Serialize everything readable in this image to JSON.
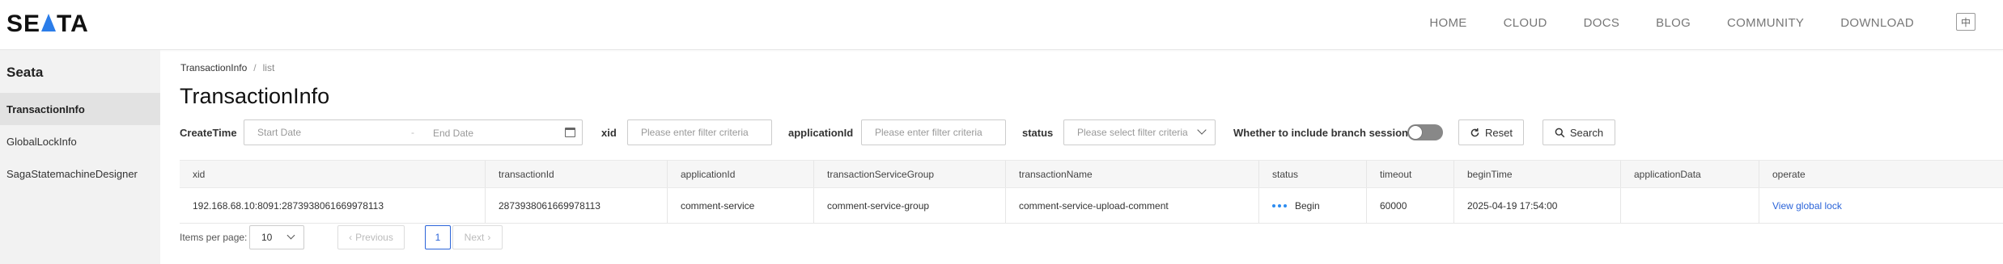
{
  "brand": {
    "logo_text_left": "SE",
    "logo_text_right": "TA"
  },
  "nav": {
    "items": [
      "HOME",
      "CLOUD",
      "DOCS",
      "BLOG",
      "COMMUNITY",
      "DOWNLOAD"
    ],
    "lang_label": "中"
  },
  "sidebar": {
    "title": "Seata",
    "items": [
      {
        "label": "TransactionInfo",
        "active": true
      },
      {
        "label": "GlobalLockInfo",
        "active": false
      },
      {
        "label": "SagaStatemachineDesigner",
        "active": false
      }
    ]
  },
  "breadcrumb": {
    "parent": "TransactionInfo",
    "separator": "/",
    "current": "list"
  },
  "page_title": "TransactionInfo",
  "filters": {
    "create_time_label": "CreateTime",
    "start_date_placeholder": "Start Date",
    "date_separator": "-",
    "end_date_placeholder": "End Date",
    "xid_label": "xid",
    "xid_placeholder": "Please enter filter criteria",
    "application_id_label": "applicationId",
    "application_id_placeholder": "Please enter filter criteria",
    "status_label": "status",
    "status_placeholder": "Please select filter criteria",
    "branch_sessions_label": "Whether to include branch sessions",
    "branch_sessions_enabled": false,
    "reset_label": "Reset",
    "search_label": "Search"
  },
  "table": {
    "columns": [
      "xid",
      "transactionId",
      "applicationId",
      "transactionServiceGroup",
      "transactionName",
      "status",
      "timeout",
      "beginTime",
      "applicationData",
      "operate"
    ],
    "rows": [
      {
        "xid": "192.168.68.10:8091:2873938061669978113",
        "transactionId": "2873938061669978113",
        "applicationId": "comment-service",
        "transactionServiceGroup": "comment-service-group",
        "transactionName": "comment-service-upload-comment",
        "status": "Begin",
        "timeout": "60000",
        "beginTime": "2025-04-19 17:54:00",
        "applicationData": "",
        "operate": "View global lock"
      }
    ]
  },
  "pagination": {
    "items_per_page_label": "Items per page:",
    "page_size": "10",
    "previous_label": "Previous",
    "current_page": "1",
    "next_label": "Next"
  },
  "colors": {
    "accent": "#2b64d9",
    "status_dot": "#2d8cf0",
    "sidebar_bg": "#f2f2f2"
  }
}
